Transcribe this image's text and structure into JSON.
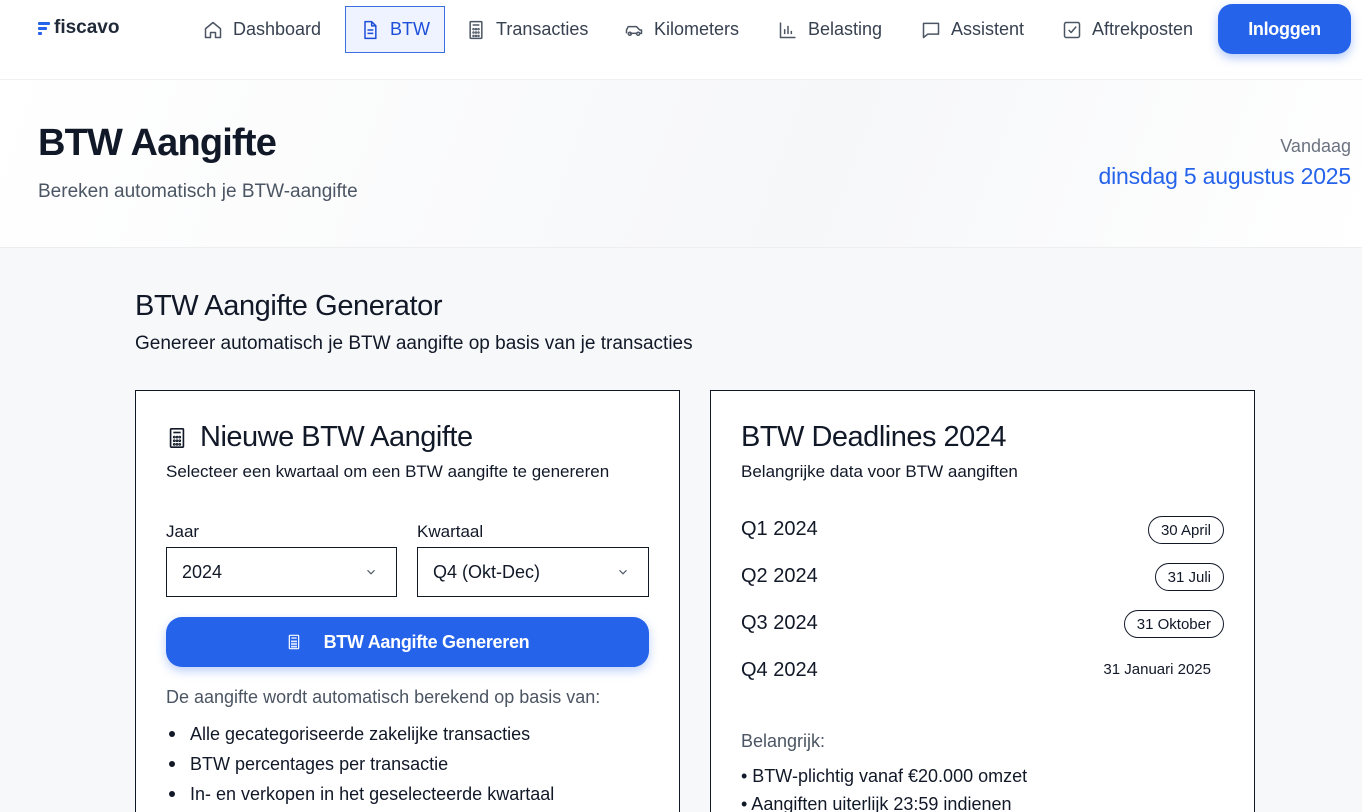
{
  "brand": {
    "name": "fiscavo",
    "accent": "#2563eb"
  },
  "nav": {
    "items": [
      {
        "label": "Dashboard",
        "icon": "home-icon"
      },
      {
        "label": "BTW",
        "icon": "document-icon",
        "active": true
      },
      {
        "label": "Transacties",
        "icon": "calculator-icon"
      },
      {
        "label": "Kilometers",
        "icon": "car-icon"
      },
      {
        "label": "Belasting",
        "icon": "bar-chart-icon"
      },
      {
        "label": "Assistent",
        "icon": "chat-icon"
      },
      {
        "label": "Aftrekposten",
        "icon": "checkbox-icon"
      }
    ],
    "login_label": "Inloggen"
  },
  "header": {
    "title": "BTW Aangifte",
    "subtitle": "Bereken automatisch je BTW-aangifte",
    "today_label": "Vandaag",
    "today_date": "dinsdag 5 augustus 2025"
  },
  "generator": {
    "title": "BTW Aangifte Generator",
    "subtitle": "Genereer automatisch je BTW aangifte op basis van je transacties",
    "card": {
      "title": "Nieuwe BTW Aangifte",
      "subtitle": "Selecteer een kwartaal om een BTW aangifte te genereren",
      "year_label": "Jaar",
      "year_value": "2024",
      "quarter_label": "Kwartaal",
      "quarter_value": "Q4 (Okt-Dec)",
      "button_label": "BTW Aangifte Genereren",
      "explain": "De aangifte wordt automatisch berekend op basis van:",
      "bullets": [
        "Alle gecategoriseerde zakelijke transacties",
        "BTW percentages per transactie",
        "In- en verkopen in het geselecteerde kwartaal"
      ]
    }
  },
  "deadlines": {
    "title": "BTW Deadlines 2024",
    "subtitle": "Belangrijke data voor BTW aangiften",
    "rows": [
      {
        "quarter": "Q1 2024",
        "date": "30 April"
      },
      {
        "quarter": "Q2 2024",
        "date": "31 Juli"
      },
      {
        "quarter": "Q3 2024",
        "date": "31 Oktober"
      },
      {
        "quarter": "Q4 2024",
        "date": "31 Januari 2025"
      }
    ],
    "important_label": "Belangrijk:",
    "important_items": [
      "• BTW-plichtig vanaf €20.000 omzet",
      "• Aangiften uiterlijk 23:59 indienen"
    ]
  }
}
